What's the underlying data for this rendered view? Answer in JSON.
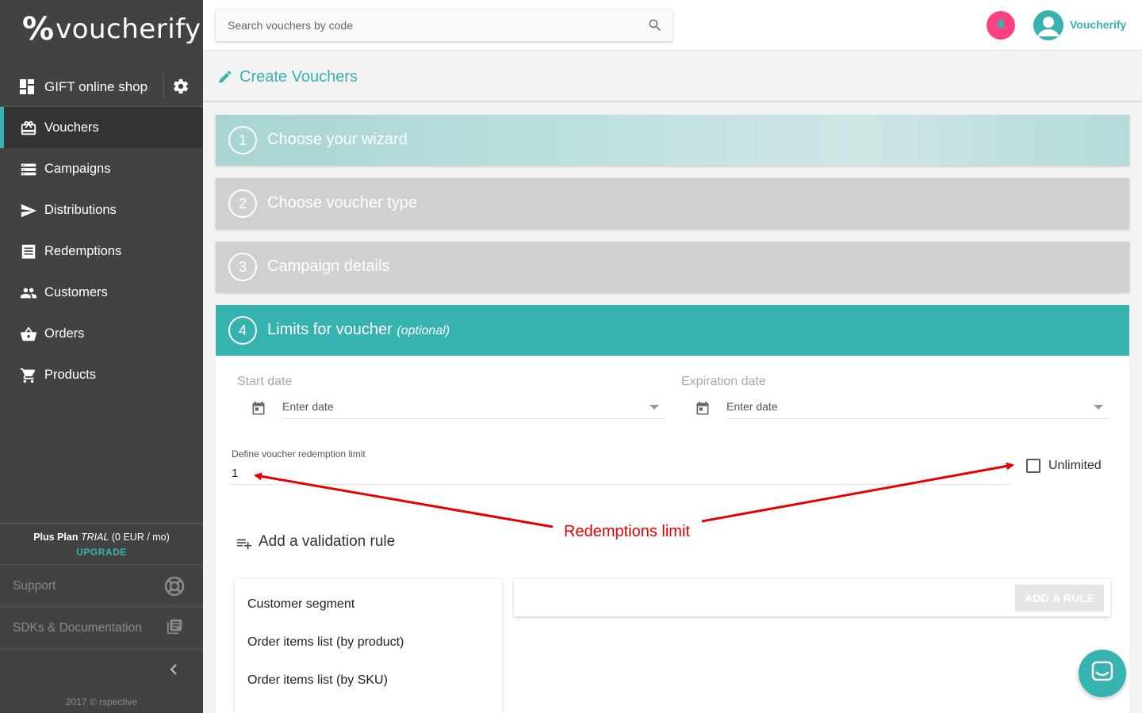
{
  "app": {
    "logo_mark": "%",
    "logo_text": "voucherify"
  },
  "sidebar": {
    "project_label": "GIFT online shop",
    "items": [
      {
        "label": "Vouchers",
        "icon": "voucher-icon",
        "active": true
      },
      {
        "label": "Campaigns",
        "icon": "campaigns-icon"
      },
      {
        "label": "Distributions",
        "icon": "send-icon"
      },
      {
        "label": "Redemptions",
        "icon": "receipt-icon"
      },
      {
        "label": "Customers",
        "icon": "people-icon"
      },
      {
        "label": "Orders",
        "icon": "basket-icon"
      },
      {
        "label": "Products",
        "icon": "cart-icon"
      }
    ],
    "plan": {
      "name": "Plus Plan",
      "trial": "TRIAL",
      "price": "(0 EUR / mo)",
      "upgrade": "UPGRADE"
    },
    "support_label": "Support",
    "docs_label": "SDKs & Documentation",
    "copyright": "2017 © rspective"
  },
  "topbar": {
    "search_placeholder": "Search vouchers by code",
    "user_name": "Voucherify"
  },
  "page": {
    "title": "Create Vouchers"
  },
  "steps": [
    {
      "number": "1",
      "title": "Choose your wizard"
    },
    {
      "number": "2",
      "title": "Choose voucher type"
    },
    {
      "number": "3",
      "title": "Campaign details"
    },
    {
      "number": "4",
      "title": "Limits for voucher",
      "suffix": "(optional)"
    }
  ],
  "limits": {
    "start_date_label": "Start date",
    "start_date_placeholder": "Enter date",
    "expiration_date_label": "Expiration date",
    "expiration_date_placeholder": "Enter date",
    "redemption_limit_label": "Define voucher redemption limit",
    "redemption_limit_value": "1",
    "unlimited_label": "Unlimited",
    "unlimited_checked": false,
    "add_validation_rule": "Add a validation rule",
    "rule_options": [
      "Customer segment",
      "Order items list (by product)",
      "Order items list (by SKU)"
    ],
    "add_rule_button": "ADD A RULE"
  },
  "annotation": {
    "text": "Redemptions limit",
    "color": "#e60000"
  },
  "colors": {
    "accent": "#36b3ae",
    "sidebar_bg": "#424242",
    "notification": "#ff4081",
    "step_inactive": "#d0d0d0"
  }
}
